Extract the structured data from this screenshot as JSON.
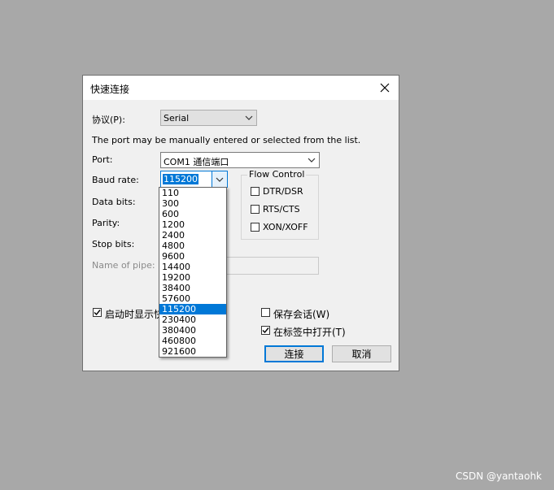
{
  "dialog": {
    "title": "快速连接",
    "protocol_label": "协议(P):",
    "protocol_value": "Serial",
    "hint": "The port may be manually entered or selected from the list.",
    "port_label": "Port:",
    "port_value": "COM1 通信端口",
    "baud_label": "Baud rate:",
    "baud_value": "115200",
    "data_bits_label": "Data bits:",
    "parity_label": "Parity:",
    "stop_bits_label": "Stop bits:",
    "pipe_label": "Name of pipe:",
    "flow_control": {
      "title": "Flow Control",
      "dtr_dsr": "DTR/DSR",
      "rts_cts": "RTS/CTS",
      "xon_xoff": "XON/XOFF"
    },
    "show_on_startup": "启动时显示快",
    "save_session": "保存会话(W)",
    "open_in_tab": "在标签中打开(T)",
    "connect_button": "连接",
    "cancel_button": "取消"
  },
  "baud_options": [
    "110",
    "300",
    "600",
    "1200",
    "2400",
    "4800",
    "9600",
    "14400",
    "19200",
    "38400",
    "57600",
    "115200",
    "230400",
    "380400",
    "460800",
    "921600"
  ],
  "selected_baud": "115200",
  "watermark": "CSDN @yantaohk",
  "colors": {
    "accent": "#0078d7",
    "backdrop": "#a8a8a8"
  }
}
